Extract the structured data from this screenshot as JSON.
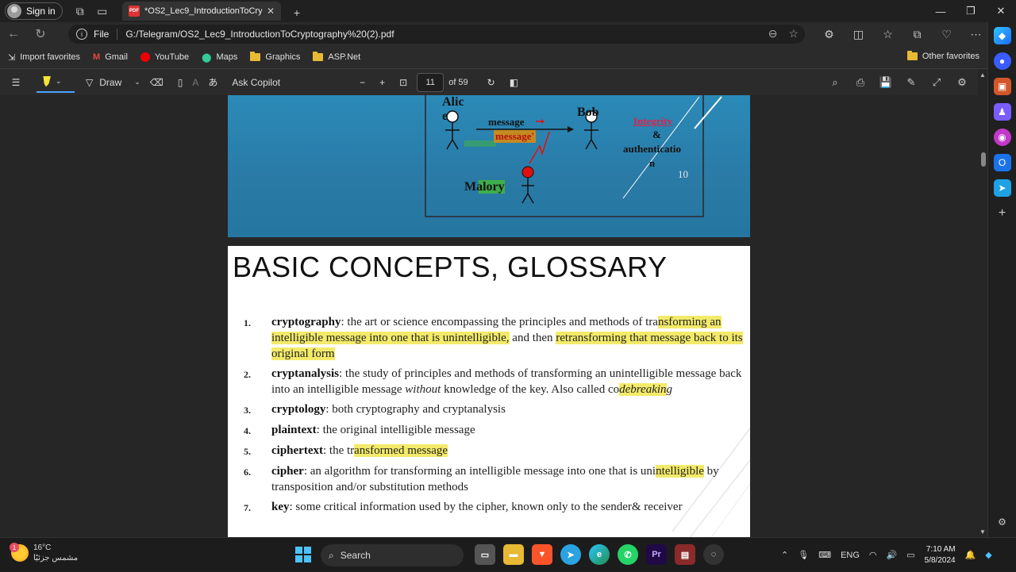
{
  "browser": {
    "sign_in": "Sign in",
    "tab_title": "*OS2_Lec9_IntroductionToCryptography%20(2).pdf",
    "file_label": "File",
    "url": "G:/Telegram/OS2_Lec9_IntroductionToCryptography%20(2).pdf"
  },
  "favorites": {
    "import": "Import favorites",
    "items": [
      "Gmail",
      "YouTube",
      "Maps",
      "Graphics",
      "ASP.Net"
    ],
    "other": "Other favorites"
  },
  "pdf_toolbar": {
    "draw": "Draw",
    "ask_copilot": "Ask Copilot",
    "page": "11",
    "of_pages": "of 59"
  },
  "slide_top": {
    "alice": "Alic\ne",
    "bob": "Bob",
    "message": "message",
    "message_prime": "message'",
    "malory": "Malory",
    "integrity": "Integrity",
    "amp": "&",
    "authentication": "authenticatio\nn",
    "number": "10"
  },
  "slide_glossary": {
    "title": "BASIC CONCEPTS,  GLOSSARY",
    "items": [
      {
        "num": "1.",
        "term": "cryptography",
        "pre": ": the art or science encompassing the principles and methods of tra",
        "hl": "nsforming an intelligible message into one that is unintelligible,",
        "post": " and then ",
        "hl2": "retransforming that message back to its original form",
        "post2": ""
      },
      {
        "num": "2.",
        "term": "cryptanalysis",
        "pre": ": the study of principles and methods of transforming an unintelligible message back into an intelligible message ",
        "em": "without",
        "post": " knowledge of the key. Also called co",
        "hl": "debreakin",
        "post2": "g"
      },
      {
        "num": "3.",
        "term": "cryptology",
        "pre": ": both cryptography and cryptanalysis"
      },
      {
        "num": "4.",
        "term": "plaintext",
        "pre": ": the original intelligible message"
      },
      {
        "num": "5.",
        "term": "ciphertext",
        "pre": ": the tr",
        "hl": "ansformed message",
        "post": ""
      },
      {
        "num": "6.",
        "term": "cipher",
        "pre": ": an algorithm for transforming an intelligible message into one that is uni",
        "hl": "ntelligible",
        "post": " by transposition and/or substitution methods"
      },
      {
        "num": "7.",
        "term": "key",
        "pre": ": some critical information used by the cipher, known only to the sender& receiver"
      }
    ]
  },
  "taskbar": {
    "temp": "16°C",
    "weather": "مشمس جزئيًا",
    "badge": "1",
    "search": "Search",
    "lang": "ENG",
    "time": "7:10 AM",
    "date": "5/8/2024"
  },
  "colors": {
    "accent": "#4aa3ff",
    "highlight": "#f3ea6a",
    "slide_blue": "#2b8ab8"
  }
}
